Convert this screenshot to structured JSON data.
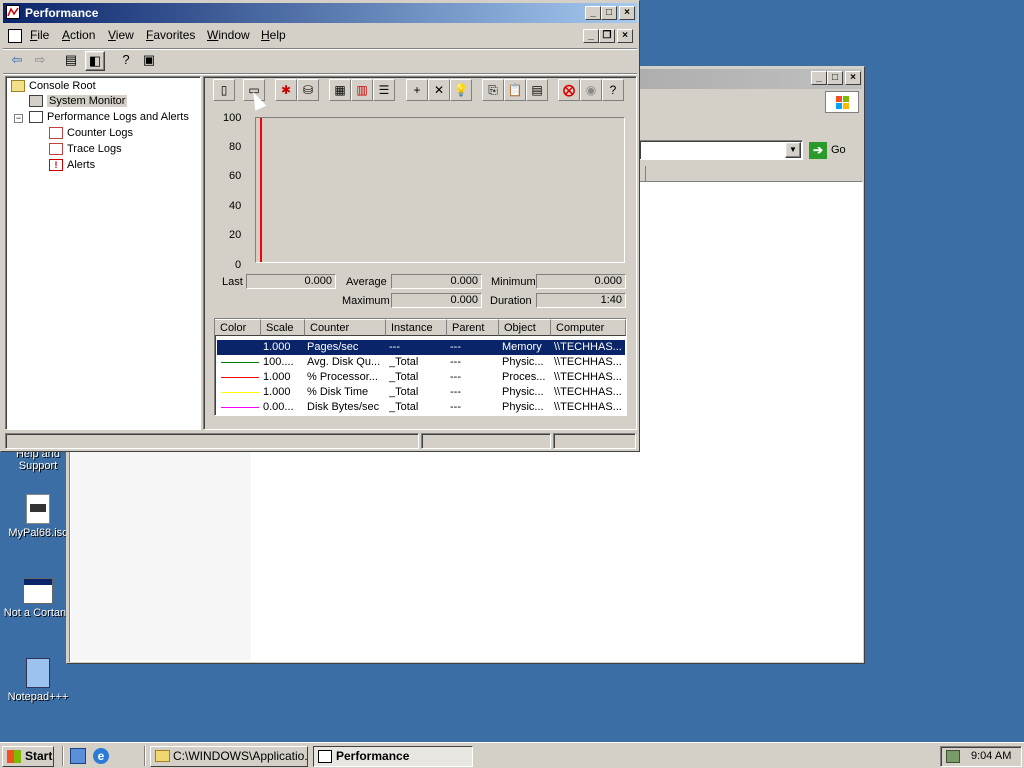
{
  "desktop": {
    "icons": [
      {
        "label": "Help and Support"
      },
      {
        "label": "MyPal68.isc"
      },
      {
        "label": "Not a Cortana"
      },
      {
        "label": "Notepad+++"
      }
    ]
  },
  "background_window": {
    "go_label": "Go"
  },
  "window": {
    "title": "Performance",
    "menu": [
      "File",
      "Action",
      "View",
      "Favorites",
      "Window",
      "Help"
    ]
  },
  "tree": {
    "root": "Console Root",
    "items": [
      "System Monitor",
      "Performance Logs and Alerts",
      "Counter Logs",
      "Trace Logs",
      "Alerts"
    ]
  },
  "chart_data": {
    "type": "line",
    "ylim": [
      0,
      100
    ],
    "yticks": [
      "100",
      "80",
      "60",
      "40",
      "20",
      "0"
    ],
    "cursor_color": "#ff0000"
  },
  "stats": {
    "last_label": "Last",
    "last_value": "0.000",
    "average_label": "Average",
    "average_value": "0.000",
    "minimum_label": "Minimum",
    "minimum_value": "0.000",
    "maximum_label": "Maximum",
    "maximum_value": "0.000",
    "duration_label": "Duration",
    "duration_value": "1:40"
  },
  "counters": {
    "headers": [
      "Color",
      "Scale",
      "Counter",
      "Instance",
      "Parent",
      "Object",
      "Computer"
    ],
    "rows": [
      {
        "color": "#0a246a",
        "scale": "1.000",
        "counter": "Pages/sec",
        "instance": "---",
        "parent": "---",
        "object": "Memory",
        "computer": "\\\\TECHHAS..."
      },
      {
        "color": "#008000",
        "scale": "100....",
        "counter": "Avg. Disk Qu...",
        "instance": "_Total",
        "parent": "---",
        "object": "Physic...",
        "computer": "\\\\TECHHAS..."
      },
      {
        "color": "#ff0000",
        "scale": "1.000",
        "counter": "% Processor...",
        "instance": "_Total",
        "parent": "---",
        "object": "Proces...",
        "computer": "\\\\TECHHAS..."
      },
      {
        "color": "#ffff00",
        "scale": "1.000",
        "counter": "% Disk Time",
        "instance": "_Total",
        "parent": "---",
        "object": "Physic...",
        "computer": "\\\\TECHHAS..."
      },
      {
        "color": "#ff00ff",
        "scale": "0.00...",
        "counter": "Disk Bytes/sec",
        "instance": "_Total",
        "parent": "---",
        "object": "Physic...",
        "computer": "\\\\TECHHAS..."
      }
    ]
  },
  "taskbar": {
    "start": "Start",
    "tasks": [
      "C:\\WINDOWS\\Applicatio...",
      "Performance"
    ],
    "clock": "9:04 AM"
  }
}
